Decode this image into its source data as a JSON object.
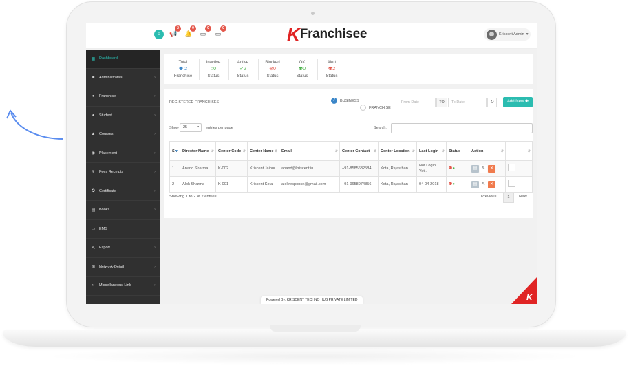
{
  "app": {
    "brand_k": "K",
    "brand_text": "Franchisee",
    "user_name": "Kriscent Admin",
    "footer": "Powered By: KRISCENT TECHNO HUB PRIVATE LIMITED"
  },
  "topbar": {
    "icons": [
      {
        "icon": "megaphone-icon",
        "badge": "2"
      },
      {
        "icon": "bell-icon",
        "badge": "0"
      },
      {
        "icon": "monitor-icon",
        "badge": "0"
      },
      {
        "icon": "desktop-icon",
        "badge": "0"
      }
    ]
  },
  "sidebar": {
    "items": [
      {
        "label": "Dashboard",
        "icon": "dashboard-icon",
        "glyph": "▦"
      },
      {
        "label": "Administrative",
        "icon": "lock-icon",
        "glyph": "🔒"
      },
      {
        "label": "Franchise",
        "icon": "users-icon",
        "glyph": "👥"
      },
      {
        "label": "Student",
        "icon": "student-icon",
        "glyph": "👤"
      },
      {
        "label": "Courses",
        "icon": "graduation-icon",
        "glyph": "🎓"
      },
      {
        "label": "Placement",
        "icon": "globe-icon",
        "glyph": "🌐"
      },
      {
        "label": "Fees Receipts",
        "icon": "rupee-icon",
        "glyph": "₹"
      },
      {
        "label": "Certificate",
        "icon": "certificate-icon",
        "glyph": "✪"
      },
      {
        "label": "Books",
        "icon": "book-icon",
        "glyph": "▤"
      },
      {
        "label": "EMS",
        "icon": "ems-icon",
        "glyph": "▭"
      },
      {
        "label": "Export",
        "icon": "export-icon",
        "glyph": "⇱"
      },
      {
        "label": "Network-Detail",
        "icon": "network-icon",
        "glyph": "⊞"
      },
      {
        "label": "Miscellaneous Link",
        "icon": "code-icon",
        "glyph": "</>"
      }
    ]
  },
  "stats": [
    {
      "label": "Total",
      "value": "2",
      "sub": "Franchise",
      "color": "#3a86c8",
      "glyph": "👥"
    },
    {
      "label": "Inactive",
      "value": "0",
      "sub": "Status",
      "color": "#4cb24c",
      "glyph": "◯"
    },
    {
      "label": "Active",
      "value": "2",
      "sub": "Status",
      "color": "#4cb24c",
      "glyph": "✔"
    },
    {
      "label": "Blocked",
      "value": "0",
      "sub": "Status",
      "color": "#e4574b",
      "glyph": "⊗"
    },
    {
      "label": "OK",
      "value": "0",
      "sub": "Status",
      "color": "#4cb24c",
      "glyph": "👥"
    },
    {
      "label": "Alert",
      "value": "2",
      "sub": "Status",
      "color": "#e4574b",
      "glyph": "👥"
    }
  ],
  "panel": {
    "title": "REGISTERED FRANCHISES",
    "radio_business": "BUSINESS",
    "radio_franchise": "FRANCHISE",
    "from_placeholder": "From Date",
    "to_label": "TO",
    "to_placeholder": "To Date",
    "add_new": "Add New",
    "show_label": "Show",
    "page_size": "25",
    "entries_label": "entries per page",
    "search_label": "Search:",
    "columns": [
      "Sr.",
      "Director Name",
      "Center Code",
      "Center Name",
      "Email",
      "Center Contact",
      "Center Location",
      "Last Login",
      "Status",
      "Action",
      ""
    ],
    "rows": [
      {
        "sr": "1",
        "director": "Anand Sharma",
        "code": "K-002",
        "center": "Kriscent Jaipur",
        "email": "anand@kriscent.in",
        "contact": "+91-8585632584",
        "location": "Kota, Rajasthan",
        "login": "Not Login Yet.."
      },
      {
        "sr": "2",
        "director": "Alok Sharma",
        "code": "K-001",
        "center": "Kriscent Kota",
        "email": "alokresponse@gmail.com",
        "contact": "+91-9658974856",
        "location": "Kota, Rajasthan",
        "login": "04-04-2018"
      }
    ],
    "showing": "Showing 1 to 2 of 2 entries",
    "prev": "Previous",
    "page": "1",
    "next": "Next"
  },
  "colors": {
    "accent": "#2bbcb0",
    "sidebar": "#303030",
    "danger": "#e4574b",
    "success": "#4cb24c"
  }
}
